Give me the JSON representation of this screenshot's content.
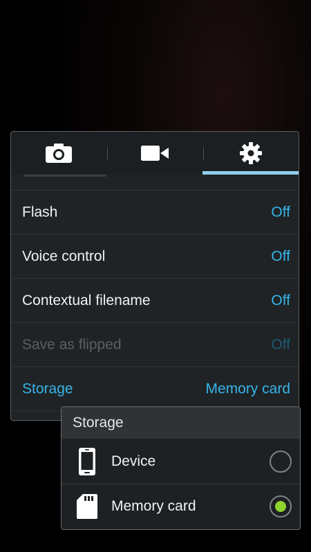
{
  "tabs": [
    {
      "icon": "camera-icon"
    },
    {
      "icon": "video-camera-icon"
    },
    {
      "icon": "gear-icon",
      "active": true
    }
  ],
  "settings": [
    {
      "label": "Flash",
      "value": "Off"
    },
    {
      "label": "Voice control",
      "value": "Off"
    },
    {
      "label": "Contextual filename",
      "value": "Off"
    },
    {
      "label": "Save as flipped",
      "value": "Off",
      "disabled": true
    },
    {
      "label": "Storage",
      "value": "Memory card",
      "highlighted": true
    }
  ],
  "storage_dialog": {
    "title": "Storage",
    "options": [
      {
        "label": "Device",
        "icon": "phone-device-icon",
        "selected": false
      },
      {
        "label": "Memory card",
        "icon": "sd-card-icon",
        "selected": true
      }
    ]
  },
  "colors": {
    "accent": "#37b5e9",
    "active_tab": "#8fd0ea",
    "radio_selected": "#8ed22e"
  }
}
